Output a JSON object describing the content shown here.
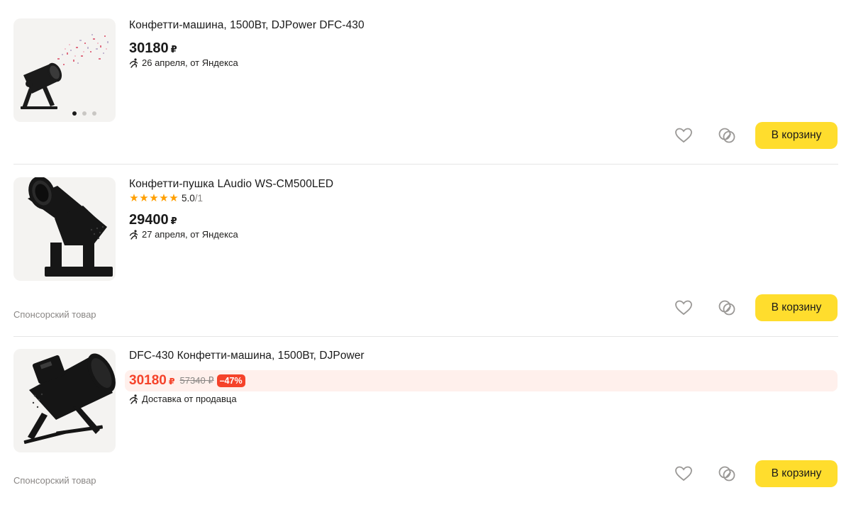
{
  "products": [
    {
      "title": "Конфетти-машина, 1500Вт, DJPower DFC-430",
      "price": "30180",
      "currency": "₽",
      "delivery": "26 апреля, от Яндекса",
      "cart_label": "В корзину",
      "gallery_dots": 3,
      "gallery_active": 1
    },
    {
      "title": "Конфетти-пушка LAudio WS-CM500LED",
      "rating_value": "5.0",
      "rating_count": "/1",
      "rating_stars": 5,
      "price": "29400",
      "currency": "₽",
      "delivery": "27 апреля, от Яндекса",
      "sponsor_label": "Спонсорский товар",
      "cart_label": "В корзину"
    },
    {
      "title": "DFC-430 Конфетти-машина, 1500Вт, DJPower",
      "price": "30180",
      "currency": "₽",
      "old_price": "57340 ₽",
      "discount": "–47%",
      "delivery": "Доставка от продавца",
      "sponsor_label": "Спонсорский товар",
      "cart_label": "В корзину"
    }
  ],
  "colors": {
    "cart_button": "#ffdd2d",
    "discount": "#f5432a",
    "promo_bg": "#fff0ec",
    "star": "#ff9f00"
  },
  "icons": {
    "favorite": "heart-icon",
    "compare": "compare-icon",
    "delivery": "running-person-icon"
  }
}
